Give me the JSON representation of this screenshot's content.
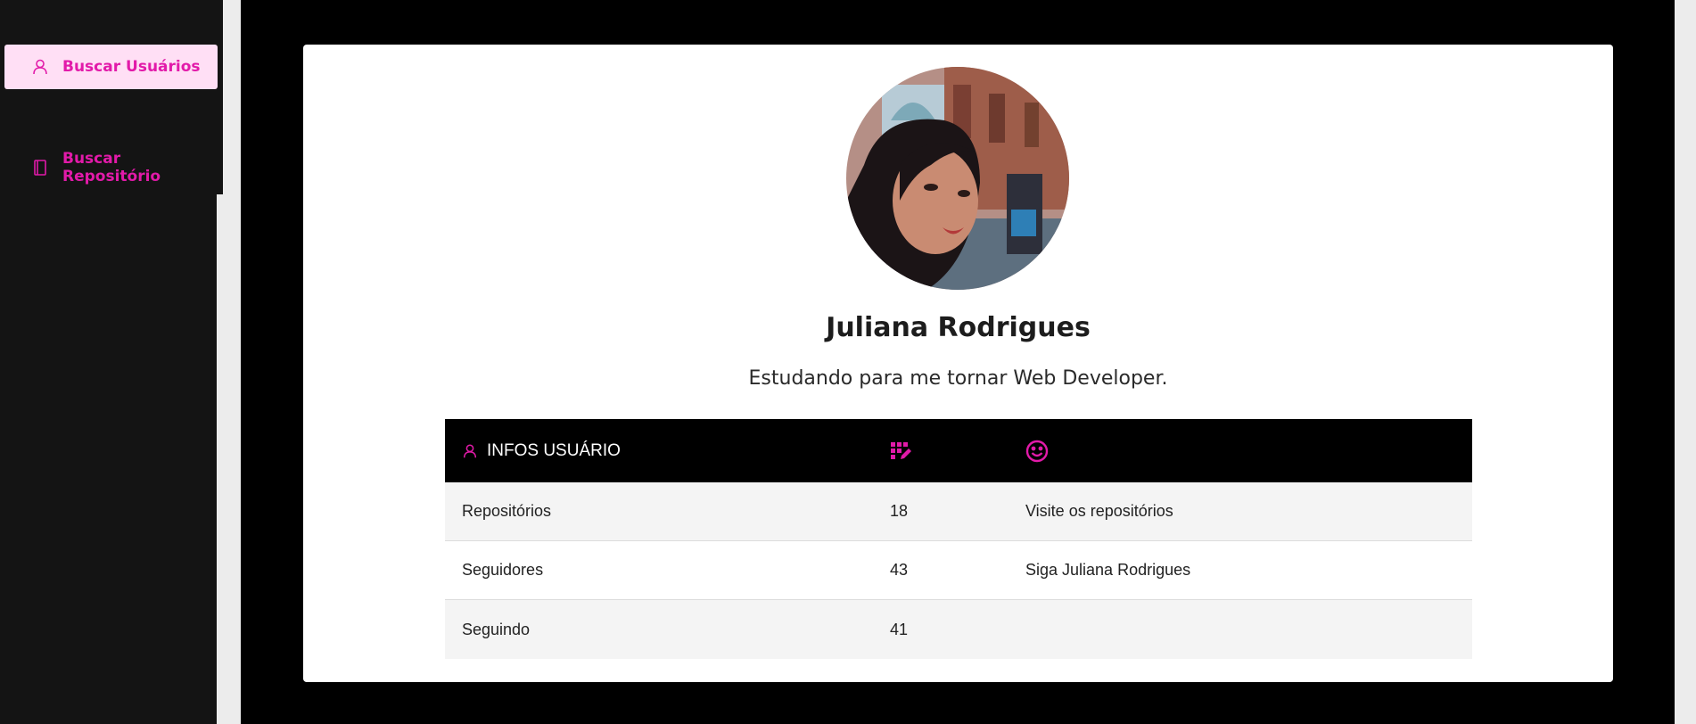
{
  "colors": {
    "accent": "#e21aa9",
    "accent_bg": "#ffdff5",
    "sidebar_bg": "#141414",
    "table_header_bg": "#000000",
    "row_alt_bg": "#f4f4f4"
  },
  "sidebar": {
    "items": [
      {
        "label": "Buscar Usuários",
        "icon": "user-icon",
        "active": true
      },
      {
        "label": "Buscar Repositório",
        "icon": "book-icon",
        "active": false
      }
    ]
  },
  "profile": {
    "name": "Juliana Rodrigues",
    "bio": "Estudando para me tornar Web Developer."
  },
  "table": {
    "header": {
      "title": "INFOS USUÁRIO",
      "title_icon": "user-icon",
      "col2_icon": "code-icon",
      "col3_icon": "smile-icon"
    },
    "rows": [
      {
        "label": "Repositórios",
        "value": "18",
        "link": "Visite os repositórios"
      },
      {
        "label": "Seguidores",
        "value": "43",
        "link": "Siga Juliana Rodrigues"
      },
      {
        "label": "Seguindo",
        "value": "41",
        "link": ""
      }
    ]
  }
}
